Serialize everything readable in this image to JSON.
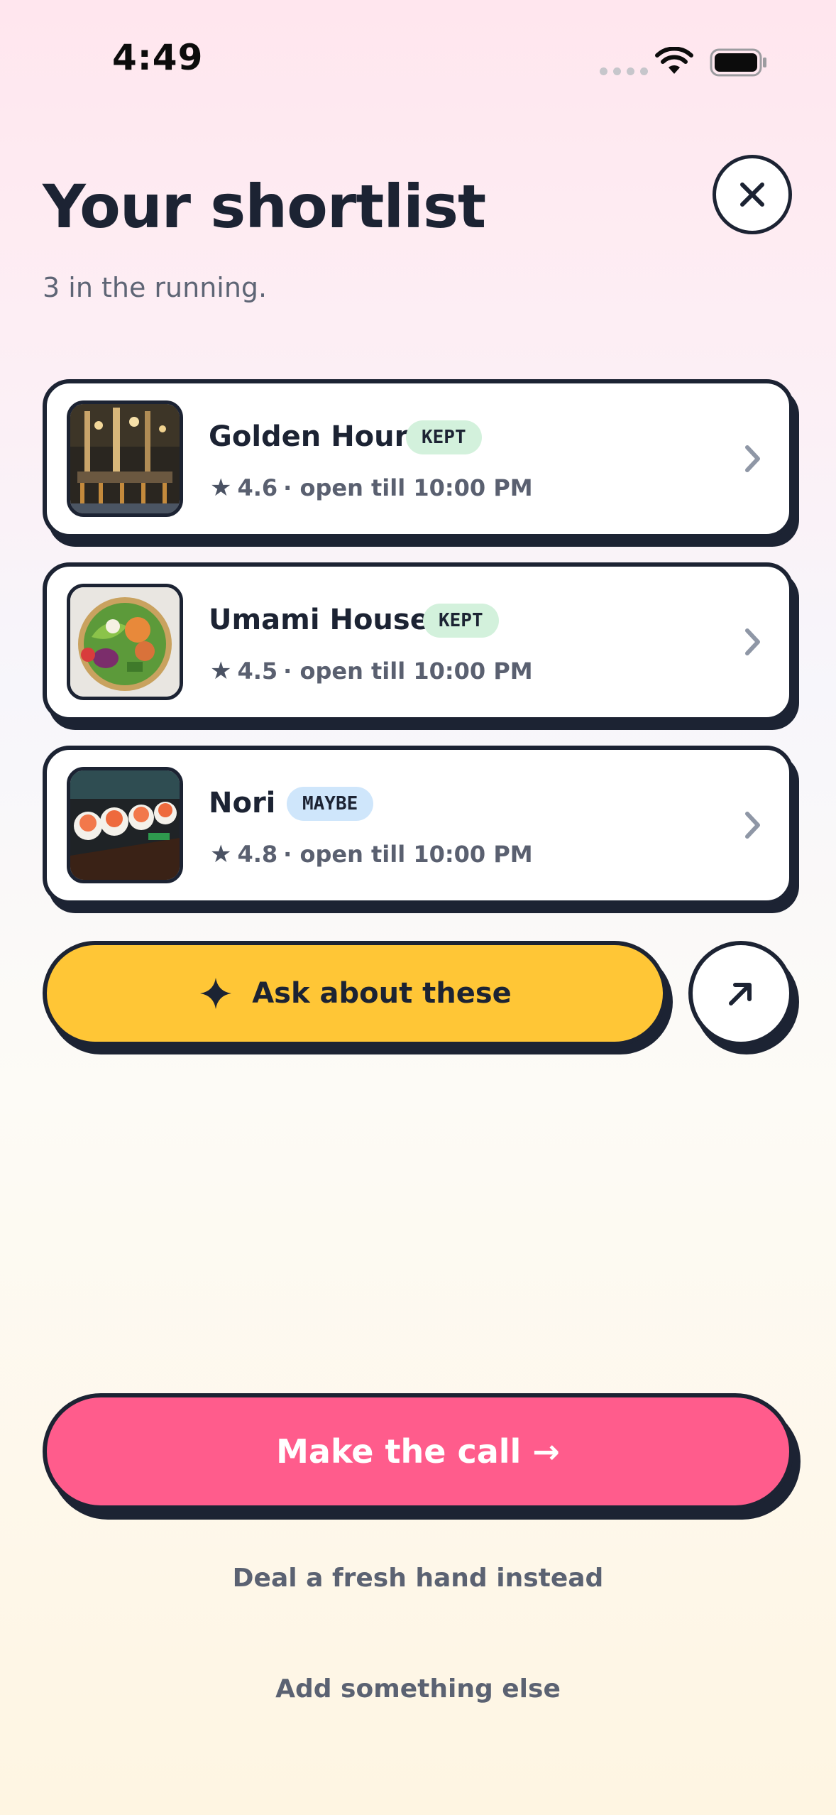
{
  "status_bar": {
    "time": "4:49"
  },
  "header": {
    "title": "Your shortlist",
    "subtitle": "3 in the running."
  },
  "shortlist": [
    {
      "name": "Golden Hour",
      "badge": "KEPT",
      "rating": "4.6",
      "hours": "· open till 10:00 PM",
      "thumb": "restaurant-interior"
    },
    {
      "name": "Umami House",
      "badge": "KEPT",
      "rating": "4.5",
      "hours": "· open till 10:00 PM",
      "thumb": "salad-bowl"
    },
    {
      "name": "Nori",
      "badge": "MAYBE",
      "rating": "4.8",
      "hours": "· open till 10:00 PM",
      "thumb": "sushi-rolls"
    }
  ],
  "actions": {
    "ask_label": "Ask about these",
    "call_label": "Make the call →",
    "fresh_hand_label": "Deal a fresh hand instead",
    "add_label": "Add something else"
  },
  "colors": {
    "ink": "#1c2333",
    "ask_yellow": "#ffc636",
    "call_pink": "#ff5c8c",
    "kept_green": "#d3f1dc",
    "maybe_blue": "#cfe6fb"
  }
}
